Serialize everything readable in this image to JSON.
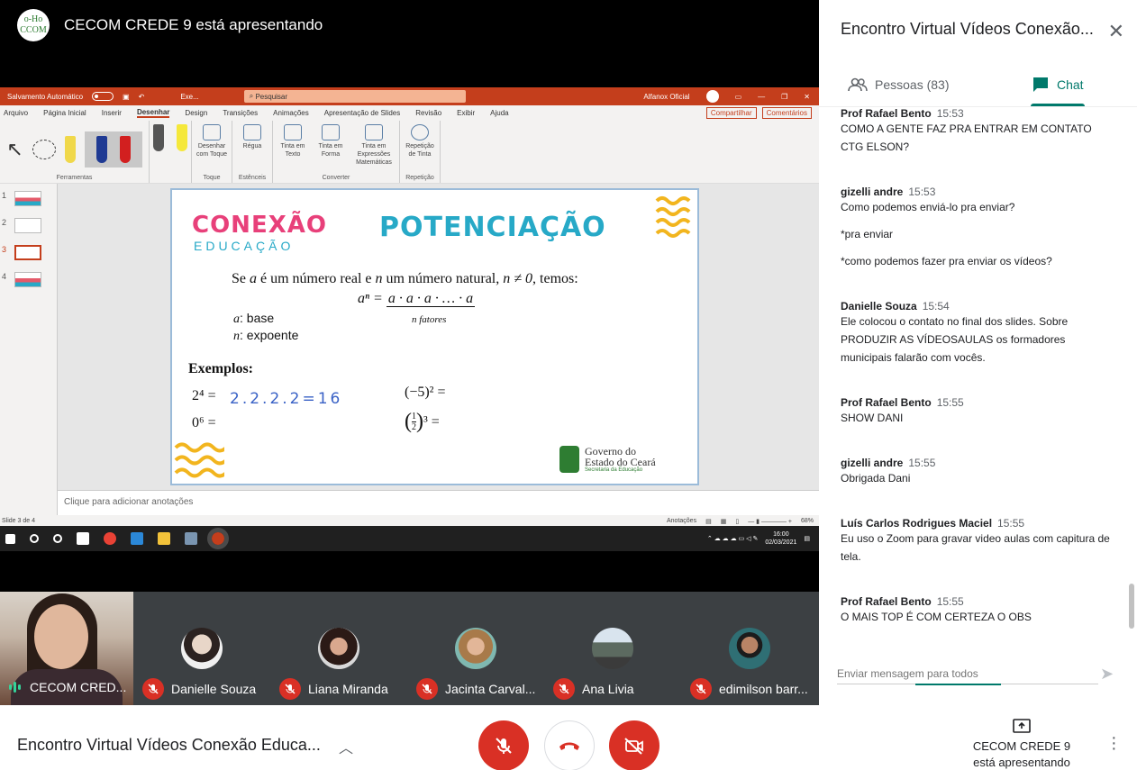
{
  "presenter": {
    "name": "CECOM CREDE 9 está apresentando",
    "avatar_text": "o-Ho CCOM"
  },
  "ppt": {
    "autosave": "Salvamento Automático",
    "filename": "Exe...",
    "search": "Pesquisar",
    "user": "Alfanox Oficial",
    "tabs": [
      "Arquivo",
      "Página Inicial",
      "Inserir",
      "Desenhar",
      "Design",
      "Transições",
      "Animações",
      "Apresentação de Slides",
      "Revisão",
      "Exibir",
      "Ajuda"
    ],
    "share": "Compartilhar",
    "comments": "Comentários",
    "ribbon": {
      "ferramentas": "Ferramentas",
      "desenhar_toque": "Desenhar com Toque",
      "toque": "Toque",
      "regua": "Régua",
      "estenceis": "Estênceis",
      "tinta_texto": "Tinta em Texto",
      "tinta_forma": "Tinta em Forma",
      "tinta_math": "Tinta em Expressões Matemáticas",
      "converter": "Converter",
      "repeticao": "Repetição de Tinta",
      "repeticao_g": "Repetição"
    },
    "thumb_numbers": [
      "1",
      "2",
      "3",
      "4"
    ],
    "notes": "Clique para adicionar anotações",
    "slide_status": "Slide 3 de 4",
    "annotations": "Anotações",
    "zoom": "68%",
    "clock_time": "16:00",
    "clock_date": "02/03/2021"
  },
  "slide": {
    "logo_top": "CONEXÃO",
    "logo_bottom": "EDUCAÇÃO",
    "title": "POTENCIAÇÃO",
    "line1_a": "Se ",
    "var_a": "a",
    "line1_b": " é um número real e ",
    "var_n": "n",
    "line1_c": " um número natural, ",
    "neq": "n ≠ 0",
    "line1_d": ", temos:",
    "formula_left": "aⁿ =",
    "formula_right": "a · a · a · … · a",
    "n_fatores": "n fatores",
    "base": ": base",
    "expoente": ": expoente",
    "exemplos": "Exemplos:",
    "ex1": "2⁴ =",
    "ex1_hand": "2.2.2.2=16",
    "ex2": "0⁶ =",
    "ex3": "(−5)² =",
    "ex4_a": "1",
    "ex4_b": "2",
    "ex4_c": "³ =",
    "gov_line1": "Governo do",
    "gov_line2": "Estado do Ceará",
    "gov_line3": "Secretaria da Educação"
  },
  "tiles": {
    "self_name": "CECOM CRED...",
    "participants": [
      {
        "name": "Danielle Souza"
      },
      {
        "name": "Liana Miranda"
      },
      {
        "name": "Jacinta Carval..."
      },
      {
        "name": "Ana Livia"
      },
      {
        "name": "edimilson barr..."
      }
    ]
  },
  "panel": {
    "title": "Encontro Virtual Vídeos Conexão...",
    "people_tab": "Pessoas (83)",
    "chat_tab": "Chat",
    "input_placeholder": "Enviar mensagem para todos",
    "messages": [
      {
        "author": "Prof Rafael Bento",
        "time": "15:53",
        "lines": [
          "COMO A GENTE FAZ PRA ENTRAR EM CONTATO CTG ELSON?"
        ]
      },
      {
        "author": "gizelli andre",
        "time": "15:53",
        "lines": [
          "Como podemos enviá-lo pra enviar?",
          "*pra enviar",
          "*como podemos fazer pra enviar os vídeos?"
        ]
      },
      {
        "author": "Danielle Souza",
        "time": "15:54",
        "lines": [
          "Ele colocou o contato no final dos slides. Sobre PRODUZIR AS VÍDEOSAULAS os formadores municipais falarão com vocês."
        ]
      },
      {
        "author": "Prof Rafael Bento",
        "time": "15:55",
        "lines": [
          "SHOW DANI"
        ]
      },
      {
        "author": "gizelli andre",
        "time": "15:55",
        "lines": [
          "Obrigada Dani"
        ]
      },
      {
        "author": "Luís Carlos Rodrigues Maciel",
        "time": "15:55",
        "lines": [
          "Eu uso o Zoom para gravar video aulas com capitura de tela."
        ]
      },
      {
        "author": "Prof Rafael Bento",
        "time": "15:55",
        "lines": [
          "O MAIS TOP É COM CERTEZA O OBS"
        ]
      }
    ]
  },
  "bottom": {
    "meeting_title": "Encontro Virtual Vídeos Conexão Educa...",
    "presenting_line1": "CECOM CREDE 9",
    "presenting_line2": "está apresentando"
  },
  "colors": {
    "accent": "#00796b",
    "danger": "#d93025",
    "ppt_red": "#c43e1c",
    "slide_cyan": "#27a9c7",
    "logo_pink": "#e8407a"
  }
}
